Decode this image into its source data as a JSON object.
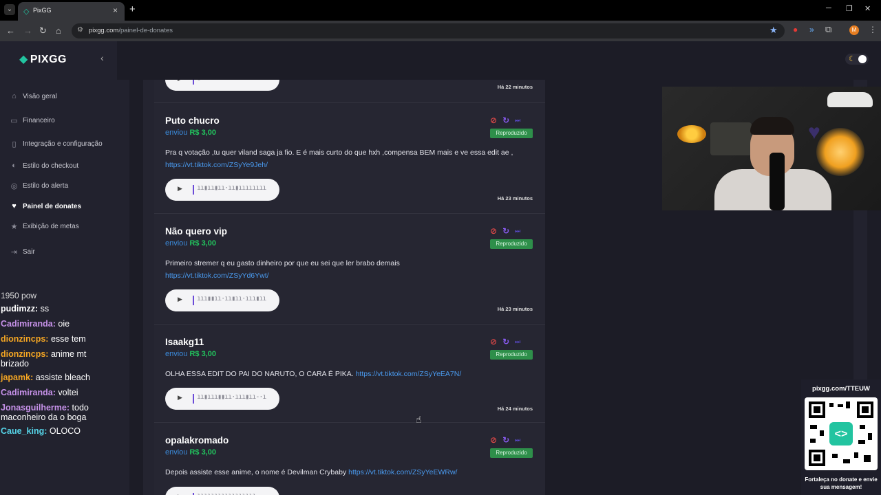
{
  "browser": {
    "tab_title": "PixGG",
    "url_domain": "pixgg.com",
    "url_path": "/painel-de-donates",
    "profile_initial": "M"
  },
  "sidebar": {
    "logo": "PIXGG",
    "items": [
      {
        "label": "Visão geral",
        "icon": "home-icon"
      },
      {
        "label": "Financeiro",
        "icon": "wallet-icon"
      },
      {
        "label": "Integração e configuração",
        "icon": "plug-icon"
      },
      {
        "label": "Estilo do checkout",
        "icon": "palette-icon"
      },
      {
        "label": "Estilo do alerta",
        "icon": "bell-icon"
      },
      {
        "label": "Painel de donates",
        "icon": "donate-icon",
        "active": true
      },
      {
        "label": "Exibição de metas",
        "icon": "star-icon"
      },
      {
        "label": "Sair",
        "icon": "logout-icon"
      }
    ]
  },
  "donations": {
    "partial_time": "Há 22 minutos",
    "items": [
      {
        "name": "Puto chucro",
        "sent_label": "enviou",
        "amount": "R$ 3,00",
        "status": "Reproduzido",
        "message": "Pra q votação ,tu quer viland saga ja fio. E é mais curto do que hxh ,compensa BEM mais e ve essa edit ae ,",
        "link": "https://vt.tiktok.com/ZSyYe9Jeh/",
        "time": "Há 23 minutos"
      },
      {
        "name": "Não quero vip",
        "sent_label": "enviou",
        "amount": "R$ 3,00",
        "status": "Reproduzido",
        "message": "Primeiro stremer q eu gasto dinheiro por que eu sei que ler brabo demais",
        "link": "https://vt.tiktok.com/ZSyYd6Ywt/",
        "time": "Há 23 minutos"
      },
      {
        "name": "Isaakg11",
        "sent_label": "enviou",
        "amount": "R$ 3,00",
        "status": "Reproduzido",
        "message": "OLHA ESSA EDIT DO PAI DO NARUTO, O CARA É PIKA.",
        "link": "https://vt.tiktok.com/ZSyYeEA7N/",
        "time": "Há 24 minutos"
      },
      {
        "name": "opalakromado",
        "sent_label": "enviou",
        "amount": "R$ 3,00",
        "status": "Reproduzido",
        "message": "Depois assiste esse anime, o nome é Devilman Crybaby",
        "link": "https://vt.tiktok.com/ZSyYeEWRw/",
        "time": ""
      }
    ]
  },
  "chat": [
    {
      "user": "",
      "text": "1950 pow",
      "color": "#ffffff"
    },
    {
      "user": "pudimzz:",
      "text": "ss",
      "color": "#ffffff"
    },
    {
      "user": "Cadimiranda:",
      "text": "oie",
      "color": "#c792ea"
    },
    {
      "user": "dionzincps:",
      "text": "esse tem",
      "color": "#f5a623"
    },
    {
      "user": "dionzincps:",
      "text": "anime mt brizado",
      "color": "#f5a623"
    },
    {
      "user": "japamk:",
      "text": "assiste bleach",
      "color": "#f5a623"
    },
    {
      "user": "Cadimiranda:",
      "text": "voltei",
      "color": "#c792ea"
    },
    {
      "user": "Jonasguilherme:",
      "text": "todo maconheiro da o boga",
      "color": "#c792ea"
    },
    {
      "user": "Caue_king:",
      "text": "OLOCO",
      "color": "#56d4e8"
    }
  ],
  "promo": {
    "url": "pixgg.com/TTEUW",
    "caption": "Fortaleça no donate e envie sua mensagem!"
  }
}
